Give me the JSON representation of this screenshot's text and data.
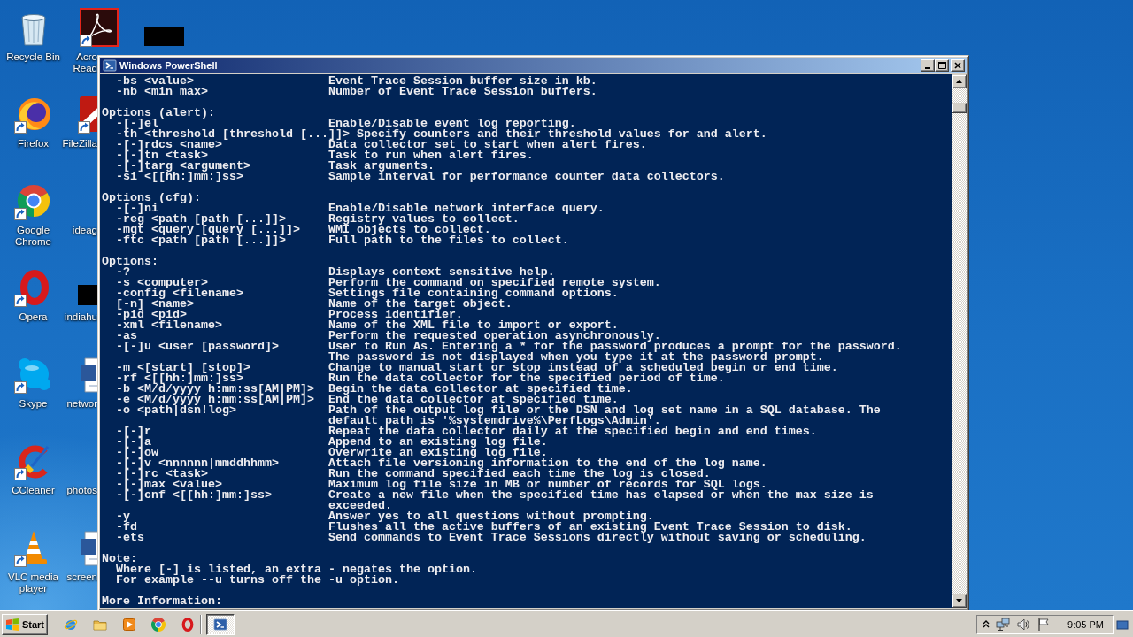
{
  "desktop": {
    "icons": [
      {
        "kind": "recyclebin",
        "label_lines": [
          "Recycle Bin"
        ]
      },
      {
        "kind": "firefox",
        "label_lines": [
          "Firefox"
        ]
      },
      {
        "kind": "chrome",
        "label_lines": [
          "Google",
          "Chrome"
        ]
      },
      {
        "kind": "opera",
        "label_lines": [
          "Opera"
        ]
      },
      {
        "kind": "skype",
        "label_lines": [
          "Skype"
        ]
      },
      {
        "kind": "ccleaner",
        "label_lines": [
          "CCleaner"
        ]
      },
      {
        "kind": "vlc",
        "label_lines": [
          "VLC media",
          "player"
        ]
      },
      {
        "kind": "acrobat",
        "label_lines": [
          "Acro",
          "Read"
        ]
      },
      {
        "kind": "filezilla",
        "label_lines": [
          "FileZilla"
        ]
      },
      {
        "kind": "blank",
        "label_lines": [
          "ideag"
        ]
      },
      {
        "kind": "redacted",
        "label_lines": [
          "indiahu"
        ]
      },
      {
        "kind": "word",
        "label_lines": [
          "networ"
        ]
      },
      {
        "kind": "blank",
        "label_lines": [
          "photos"
        ]
      },
      {
        "kind": "word",
        "label_lines": [
          "screen"
        ]
      },
      {
        "kind": "redacted"
      }
    ]
  },
  "window": {
    "title": "Windows PowerShell"
  },
  "console": {
    "sections": [
      {
        "kind": "options",
        "items": [
          {
            "option": "-bs <value>",
            "description": [
              "Event Trace Session buffer size in kb."
            ]
          },
          {
            "option": "-nb <min max>",
            "description": [
              "Number of Event Trace Session buffers."
            ]
          }
        ]
      },
      {
        "kind": "options",
        "heading": "Options (alert):",
        "items": [
          {
            "option": "-[-]el",
            "description": [
              "Enable/Disable event log reporting."
            ]
          },
          {
            "option": "-th <threshold [threshold [...]]>",
            "description": [
              "Specify counters and their threshold values for and alert."
            ]
          },
          {
            "option": "-[-]rdcs <name>",
            "description": [
              "Data collector set to start when alert fires."
            ]
          },
          {
            "option": "-[-]tn <task>",
            "description": [
              "Task to run when alert fires."
            ]
          },
          {
            "option": "-[-]targ <argument>",
            "description": [
              "Task arguments."
            ]
          },
          {
            "option": "-si <[[hh:]mm:]ss>",
            "description": [
              "Sample interval for performance counter data collectors."
            ]
          }
        ]
      },
      {
        "kind": "options",
        "heading": "Options (cfg):",
        "items": [
          {
            "option": "-[-]ni",
            "description": [
              "Enable/Disable network interface query."
            ]
          },
          {
            "option": "-reg <path [path [...]]>",
            "description": [
              "Registry values to collect."
            ]
          },
          {
            "option": "-mgt <query [query [...]]>",
            "description": [
              "WMI objects to collect."
            ]
          },
          {
            "option": "-ftc <path [path [...]]>",
            "description": [
              "Full path to the files to collect."
            ]
          }
        ]
      },
      {
        "kind": "options",
        "heading": "Options:",
        "items": [
          {
            "option": "-?",
            "description": [
              "Displays context sensitive help."
            ]
          },
          {
            "option": "-s <computer>",
            "description": [
              "Perform the command on specified remote system."
            ]
          },
          {
            "option": "-config <filename>",
            "description": [
              "Settings file containing command options."
            ]
          },
          {
            "option": "[-n] <name>",
            "description": [
              "Name of the target object."
            ]
          },
          {
            "option": "-pid <pid>",
            "description": [
              "Process identifier."
            ]
          },
          {
            "option": "-xml <filename>",
            "description": [
              "Name of the XML file to import or export."
            ]
          },
          {
            "option": "-as",
            "description": [
              "Perform the requested operation asynchronously."
            ]
          },
          {
            "option": "-[-]u <user [password]>",
            "description": [
              "User to Run As. Entering a * for the password produces a prompt for the password.",
              "The password is not displayed when you type it at the password prompt."
            ]
          },
          {
            "option": "-m <[start] [stop]>",
            "description": [
              "Change to manual start or stop instead of a scheduled begin or end time."
            ]
          },
          {
            "option": "-rf <[[hh:]mm:]ss>",
            "description": [
              "Run the data collector for the specified period of time."
            ]
          },
          {
            "option": "-b <M/d/yyyy h:mm:ss[AM|PM]>",
            "description": [
              "Begin the data collector at specified time."
            ]
          },
          {
            "option": "-e <M/d/yyyy h:mm:ss[AM|PM]>",
            "description": [
              "End the data collector at specified time."
            ]
          },
          {
            "option": "-o <path|dsn!log>",
            "description": [
              "Path of the output log file or the DSN and log set name in a SQL database. The",
              "default path is '%systemdrive%\\PerfLogs\\Admin'."
            ]
          },
          {
            "option": "-[-]r",
            "description": [
              "Repeat the data collector daily at the specified begin and end times."
            ]
          },
          {
            "option": "-[-]a",
            "description": [
              "Append to an existing log file."
            ]
          },
          {
            "option": "-[-]ow",
            "description": [
              "Overwrite an existing log file."
            ]
          },
          {
            "option": "-[-]v <nnnnnn|mmddhhmm>",
            "description": [
              "Attach file versioning information to the end of the log name."
            ]
          },
          {
            "option": "-[-]rc <task>",
            "description": [
              "Run the command specified each time the log is closed."
            ]
          },
          {
            "option": "-[-]max <value>",
            "description": [
              "Maximum log file size in MB or number of records for SQL logs."
            ]
          },
          {
            "option": "-[-]cnf <[[hh:]mm:]ss>",
            "description": [
              "Create a new file when the specified time has elapsed or when the max size is",
              "exceeded."
            ]
          },
          {
            "option": "-y",
            "description": [
              "Answer yes to all questions without prompting."
            ]
          },
          {
            "option": "-fd",
            "description": [
              "Flushes all the active buffers of an existing Event Trace Session to disk."
            ]
          },
          {
            "option": "-ets",
            "description": [
              "Send commands to Event Trace Sessions directly without saving or scheduling."
            ]
          }
        ]
      },
      {
        "kind": "text",
        "heading": "Note:",
        "lines": [
          "Where [-] is listed, an extra - negates the option.",
          "For example --u turns off the -u option."
        ]
      },
      {
        "kind": "text",
        "heading": "More Information:"
      }
    ]
  },
  "taskbar": {
    "start": "Start",
    "task_buttons": [
      {
        "selected": true
      }
    ],
    "clock": "9:05 PM"
  }
}
